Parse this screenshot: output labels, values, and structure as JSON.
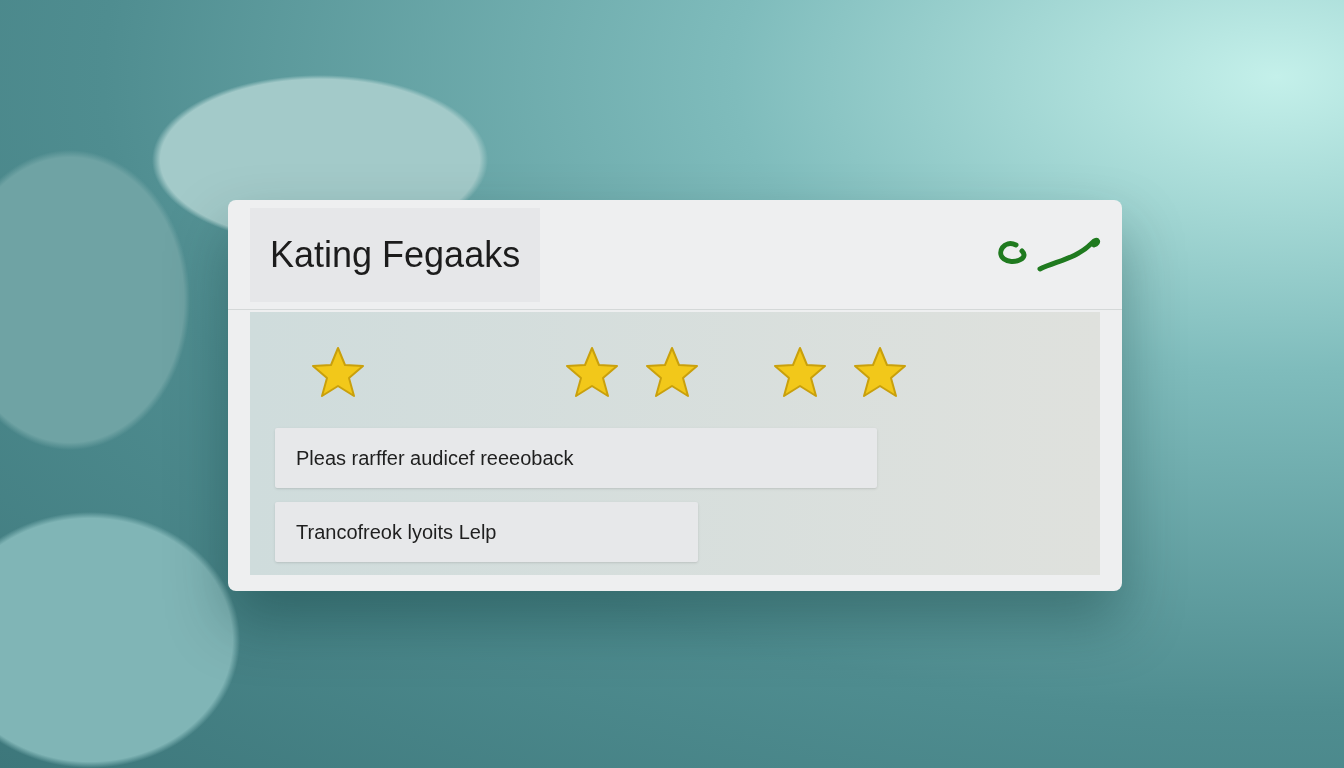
{
  "dialog": {
    "title": "Kating Fegaaks"
  },
  "rating": {
    "stars": 5
  },
  "fields": [
    {
      "value": "Pleas rarffer audicef reeeoback"
    },
    {
      "value": "Trancofreok lyoits Lelp"
    }
  ]
}
